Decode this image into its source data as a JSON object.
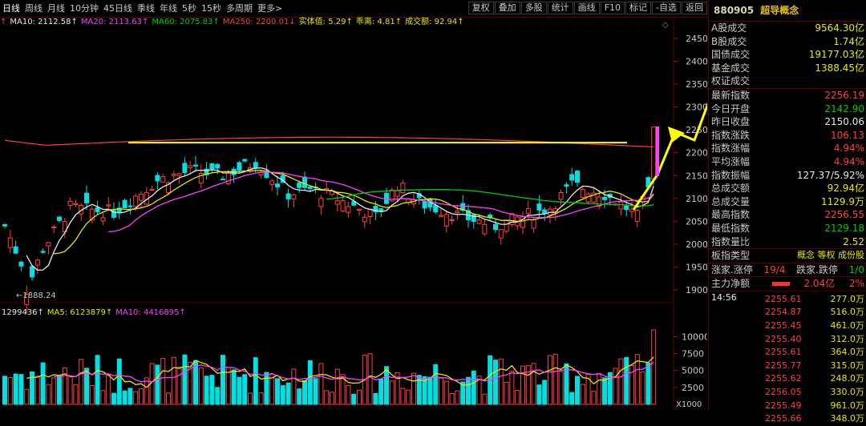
{
  "toolbar": {
    "periods": [
      "日线",
      "周线",
      "月线",
      "10分钟",
      "45日线",
      "季线",
      "年线",
      "5秒",
      "15秒",
      "多周期",
      "更多>"
    ],
    "tools": [
      "复权",
      "叠加",
      "多股",
      "统计",
      "画线",
      "F10",
      "标记",
      "-自选",
      "返回"
    ]
  },
  "ma_info": [
    {
      "text": "MA10: 2112.58↑",
      "color": "#e8e8e8"
    },
    {
      "text": "MA20: 2113.63↑",
      "color": "#ff40ff"
    },
    {
      "text": "MA60: 2075.83↑",
      "color": "#00d000"
    },
    {
      "text": "MA250: 2200.01↓",
      "color": "#ff4040"
    },
    {
      "text": "实体值: 5.29↑",
      "color": "#e8e800"
    },
    {
      "text": "乖离: 4.81↑",
      "color": "#e8e800"
    },
    {
      "text": "成交额: 92.94↑",
      "color": "#e8e800"
    }
  ],
  "vol_info": [
    {
      "text": "1299436↑",
      "color": "#e8e8e8"
    },
    {
      "text": "MA5: 6123879↑",
      "color": "#e8e800"
    },
    {
      "text": "MA10: 4416895↑",
      "color": "#ff40ff"
    }
  ],
  "price_axis": [
    "2450",
    "2400",
    "2350",
    "2300",
    "2250",
    "2200",
    "2150",
    "2100",
    "2050",
    "2000",
    "1950",
    "1900"
  ],
  "vol_axis": [
    "10000",
    "7500",
    "5000",
    "2500"
  ],
  "vol_unit": "X1000",
  "low_label": "←1888.24",
  "colors": {
    "up": "#ff4040",
    "down": "#00e0e0",
    "ma5": "#e8e8e8",
    "ma10": "#e8e800",
    "ma20": "#ff40ff",
    "ma60": "#00d000",
    "ma250": "#ff4040",
    "annot": "#ffff00"
  },
  "panel": {
    "code": "880905",
    "name": "超导概念",
    "stats": [
      {
        "k": "A股成交",
        "v": "9564.30亿",
        "c": "yel"
      },
      {
        "k": "B股成交",
        "v": "1.74亿",
        "c": "yel"
      },
      {
        "k": "国债成交",
        "v": "19177.03亿",
        "c": "yel"
      },
      {
        "k": "基金成交",
        "v": "1388.45亿",
        "c": "yel"
      },
      {
        "k": "权证成交",
        "v": "",
        "c": "yel"
      }
    ],
    "quote": [
      {
        "k": "最新指数",
        "v": "2256.19",
        "c": "red"
      },
      {
        "k": "今日开盘",
        "v": "2142.90",
        "c": "grn"
      },
      {
        "k": "昨日收盘",
        "v": "2150.06",
        "c": "wht"
      },
      {
        "k": "指数涨跌",
        "v": "106.13",
        "c": "red"
      },
      {
        "k": "指数涨幅",
        "v": "4.94%",
        "c": "red"
      },
      {
        "k": "平均涨幅",
        "v": "4.94%",
        "c": "red"
      },
      {
        "k": "指数振幅",
        "v": "127.37/5.92%",
        "c": "wht"
      },
      {
        "k": "总成交额",
        "v": "92.94亿",
        "c": "yel"
      },
      {
        "k": "总成交量",
        "v": "1129.9万",
        "c": "yel"
      },
      {
        "k": "最高指数",
        "v": "2256.55",
        "c": "red"
      },
      {
        "k": "最低指数",
        "v": "2129.18",
        "c": "grn"
      },
      {
        "k": "指数量比",
        "v": "2.52",
        "c": "yel"
      }
    ],
    "type_label": "板指类型",
    "type_value": "概念 等权 成份股",
    "updown_label": "涨家.涨停",
    "updown_value": "19/4",
    "downlimit_label": "跌家.跌停",
    "downlimit_value": "1/0",
    "flow_label": "主力净额",
    "flow_value": "2.04亿",
    "flow_pct": "2%",
    "time": "14:56",
    "ticks": [
      {
        "p": "2255.61",
        "v": "277.0万"
      },
      {
        "p": "2254.87",
        "v": "516.0万"
      },
      {
        "p": "2255.45",
        "v": "461.0万"
      },
      {
        "p": "2255.40",
        "v": "312.0万"
      },
      {
        "p": "2255.61",
        "v": "364.0万"
      },
      {
        "p": "2255.77",
        "v": "315.0万"
      },
      {
        "p": "2255.62",
        "v": "248.0万"
      },
      {
        "p": "2256.05",
        "v": "330.0万"
      },
      {
        "p": "2255.49",
        "v": "961.0万"
      },
      {
        "p": "2255.66",
        "v": "348.0万"
      }
    ]
  }
}
